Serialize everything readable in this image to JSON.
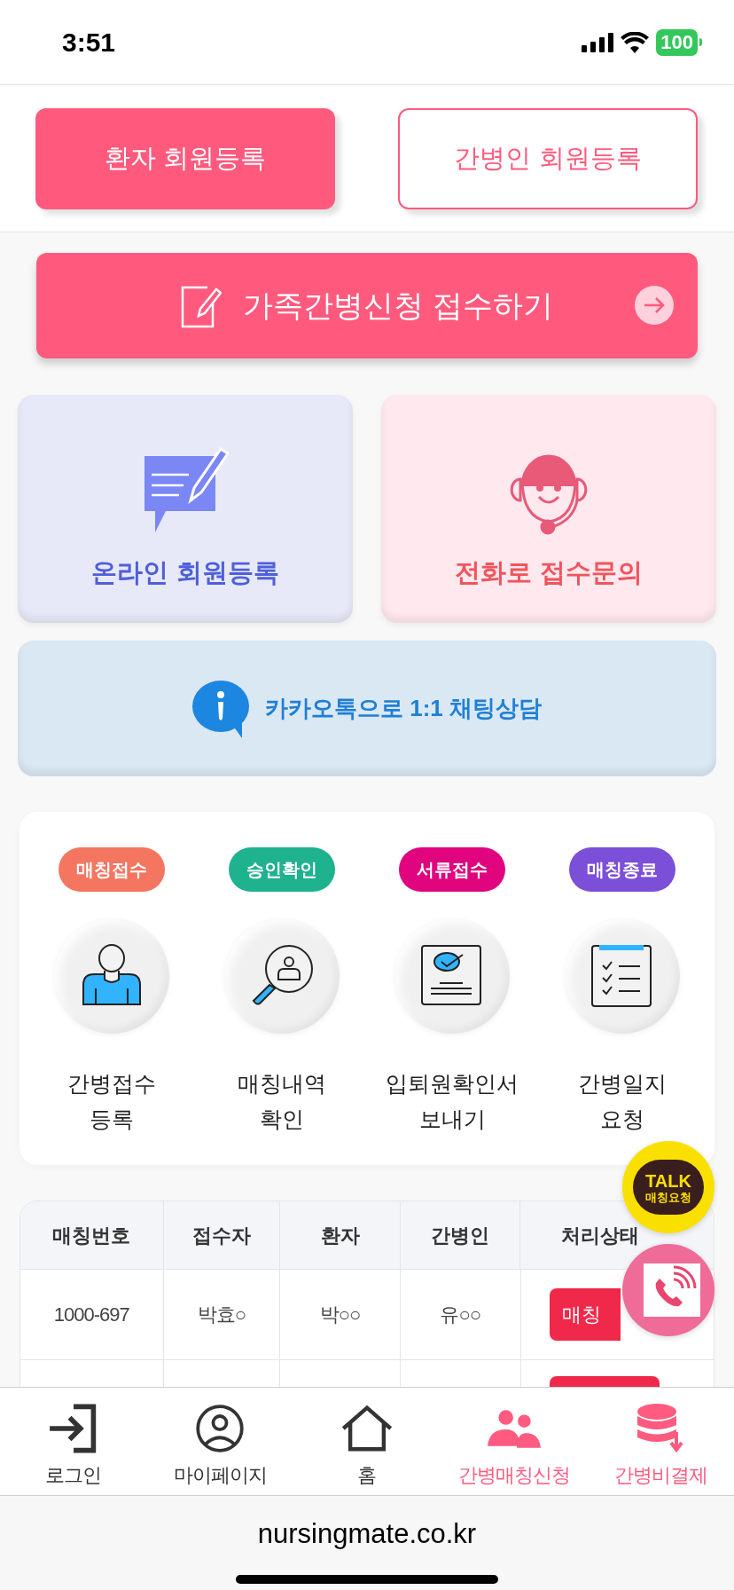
{
  "status_bar": {
    "time": "3:51",
    "battery": "100"
  },
  "register_buttons": [
    {
      "label": "환자 회원등록",
      "kind": "filled"
    },
    {
      "label": "간병인 회원등록",
      "kind": "outline"
    }
  ],
  "apply_button": {
    "label": "가족간병신청 접수하기"
  },
  "cards": [
    {
      "label": "온라인 회원등록",
      "kind": "online"
    },
    {
      "label": "전화로 접수문의",
      "kind": "phone"
    }
  ],
  "kakao_banner": {
    "label": "카카오톡으로 1:1 채팅상담"
  },
  "steps": [
    {
      "badge": "매칭접수",
      "color": "#f47560",
      "kind": "person",
      "label": "간병접수\n등록"
    },
    {
      "badge": "승인확인",
      "color": "#1fb28f",
      "kind": "search",
      "label": "매칭내역\n확인"
    },
    {
      "badge": "서류접수",
      "color": "#e0047f",
      "kind": "certificate",
      "label": "입퇴원확인서\n보내기"
    },
    {
      "badge": "매칭종료",
      "color": "#7b4fd8",
      "kind": "checklist",
      "label": "간병일지\n요청"
    }
  ],
  "table": {
    "columns": [
      "매칭번호",
      "접수자",
      "환자",
      "간병인",
      "처리상태"
    ],
    "rows": [
      {
        "cells": [
          "1000-697",
          "박효○",
          "박○○",
          "유○○"
        ],
        "status": "매칭"
      }
    ]
  },
  "floating_talk": {
    "title": "TALK",
    "subtitle": "매칭요청"
  },
  "bottom_nav": [
    {
      "label": "로그인",
      "kind": "login",
      "accent": false
    },
    {
      "label": "마이페이지",
      "kind": "user",
      "accent": false
    },
    {
      "label": "홈",
      "kind": "home",
      "accent": false
    },
    {
      "label": "간병매칭신청",
      "kind": "people",
      "accent": true
    },
    {
      "label": "간병비결제",
      "kind": "database",
      "accent": true
    }
  ],
  "url_bar": {
    "url": "nursingmate.co.kr"
  }
}
